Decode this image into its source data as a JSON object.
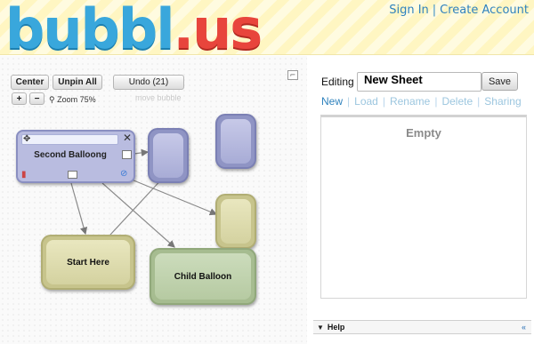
{
  "header": {
    "logo_part1": "bubbl",
    "logo_part2": ".us",
    "sign_in": "Sign In",
    "separator": "|",
    "create_account": "Create Account"
  },
  "toolbar": {
    "center": "Center",
    "unpin_all": "Unpin All",
    "undo": "Undo (21)",
    "zoom_in": "+",
    "zoom_out": "−",
    "zoom_label": "Zoom 75%",
    "move_bubble": "move bubble"
  },
  "bubbles": {
    "second": "Second Balloong",
    "start": "Start Here",
    "child": "Child Balloon"
  },
  "editor": {
    "editing_label": "Editing",
    "sheet_name": "New Sheet",
    "save": "Save",
    "actions": {
      "new": "New",
      "load": "Load",
      "rename": "Rename",
      "delete": "Delete",
      "sharing": "Sharing"
    },
    "empty": "Empty"
  },
  "help": {
    "label": "Help",
    "collapse": "«"
  },
  "colors": {
    "link": "#2f82bd",
    "link_disabled": "#9cc6df",
    "bubble_blue": "#a8acd6",
    "bubble_yellow": "#d4d2a0",
    "bubble_green": "#b6caa2"
  }
}
